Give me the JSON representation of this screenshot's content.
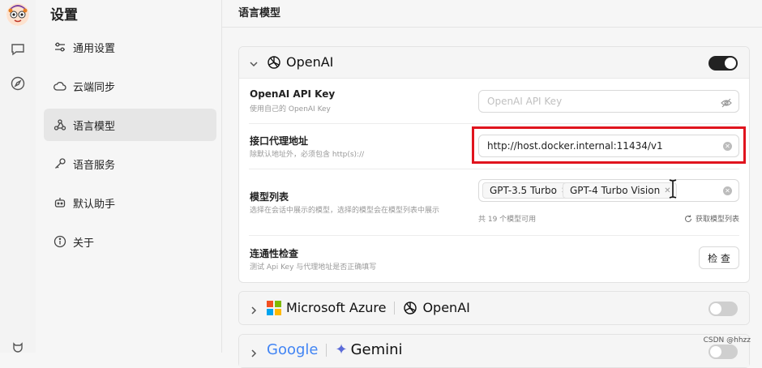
{
  "sidebar": {
    "title": "设置",
    "items": [
      {
        "label": "通用设置",
        "icon": "sliders-icon"
      },
      {
        "label": "云端同步",
        "icon": "cloud-icon"
      },
      {
        "label": "语言模型",
        "icon": "webhook-icon",
        "active": true
      },
      {
        "label": "语音服务",
        "icon": "key-icon"
      },
      {
        "label": "默认助手",
        "icon": "bot-icon"
      },
      {
        "label": "关于",
        "icon": "info-icon"
      }
    ]
  },
  "main": {
    "title": "语言模型",
    "openai": {
      "name": "OpenAI",
      "enabled": true,
      "api_key": {
        "label": "OpenAI API Key",
        "desc": "使用自己的 OpenAI Key",
        "placeholder": "OpenAI API Key"
      },
      "proxy": {
        "label": "接口代理地址",
        "desc": "除默认地址外，必须包含 http(s)://",
        "value": "http://host.docker.internal:11434/v1"
      },
      "models": {
        "label": "模型列表",
        "desc": "选择在会话中展示的模型，选择的模型会在模型列表中展示",
        "tags": [
          "GPT-3.5 Turbo",
          "GPT-4 Turbo Vision"
        ],
        "count_text": "共 19 个模型可用",
        "fetch_label": "获取模型列表"
      },
      "check": {
        "label": "连通性检查",
        "desc": "测试 Api Key 与代理地址是否正确填写",
        "button": "检 查"
      }
    },
    "azure": {
      "name": "Microsoft Azure",
      "secondary": "OpenAI",
      "enabled": false
    },
    "google": {
      "name": "Google",
      "secondary": "Gemini"
    }
  },
  "watermark": "CSDN @hhzz",
  "colors": {
    "highlight": "#e0141e",
    "toggle_on": "#222222"
  }
}
